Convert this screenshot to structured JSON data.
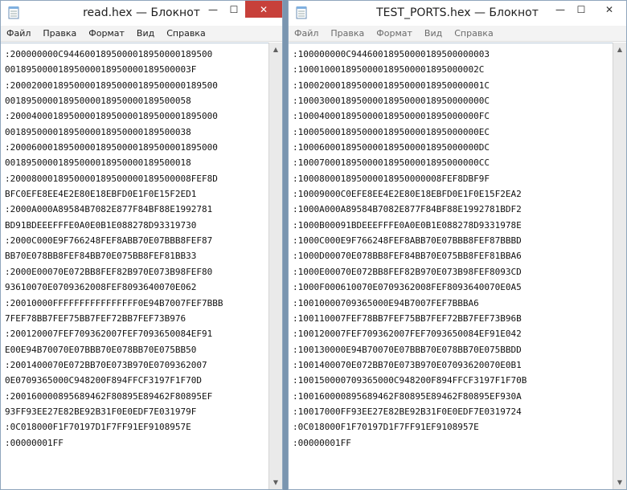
{
  "left_window": {
    "title": "read.hex — Блокнот",
    "menu": [
      "Файл",
      "Правка",
      "Формат",
      "Вид",
      "Справка"
    ],
    "close_glyph": "✕",
    "min_glyph": "—",
    "max_glyph": "☐",
    "lines": [
      ":200000000C9446001895000018950000189500",
      "00189500001895000018950000189500003F",
      ":200020001895000018950000189500000189500",
      "00189500001895000018950000189500058",
      ":200040001895000018950000189500001895000",
      "00189500001895000018950000189500038",
      ":200060001895000018950000189500001895000",
      "00189500001895000018950000189500018",
      ":2000800018950000189500000189500008FEF8D",
      "BFC0EFE8EE4E2E80E18EBFD0E1F0E15F2ED1",
      ":2000A000A89584B7082E877F84BF88E1992781",
      "BD91BDEEEFFFE0A0E0B1E088278D93319730",
      ":2000C000E9F766248FEF8ABB70E07BBB8FEF87",
      "BB70E078BB8FEF84BB70E075BB8FEF81BB33",
      ":2000E00070E072BB8FEF82B970E073B98FEF80",
      "93610070E0709362008FEF8093640070E062",
      ":20010000FFFFFFFFFFFFFFFF0E94B7007FEF7BBB",
      "7FEF78BB7FEF75BB7FEF72BB7FEF73B976",
      ":200120007FEF709362007FEF7093650084EF91",
      "E00E94B70070E07BBB70E078BB70E075BB50",
      ":2001400070E072BB70E073B970E0709362007",
      "0E0709365000C948200F894FFCF3197F1F70D",
      ":200160000895689462F80895E89462F80895EF",
      "93FF93EE27E82BE92B31F0E0EDF7E031979F",
      ":0C018000F1F70197D1F7FF91EF9108957E",
      ":00000001FF"
    ]
  },
  "right_window": {
    "title": "TEST_PORTS.hex — Блокнот",
    "menu": [
      "Файл",
      "Правка",
      "Формат",
      "Вид",
      "Справка"
    ],
    "close_glyph": "✕",
    "min_glyph": "—",
    "max_glyph": "☐",
    "lines": [
      ":100000000C94460018950000189500000003",
      ":1000100018950000189500001895000002C",
      ":10002000189500001895000018950000001C",
      ":10003000189500001895000018950000000C",
      ":1000400018950000189500001895000000FC",
      ":1000500018950000189500001895000000EC",
      ":1000600018950000189500001895000000DC",
      ":1000700018950000189500001895000000CC",
      ":100080001895000018950000008FEF8DBF9F",
      ":10009000C0EFE8EE4E2E80E18EBFD0E1F0E15F2EA2",
      ":1000A000A89584B7082E877F84BF88E1992781BDF2",
      ":1000B00091BDEEEFFFE0A0E0B1E088278D9331978E",
      ":1000C000E9F766248FEF8ABB70E07BBB8FEF87BBBD",
      ":1000D00070E078BB8FEF84BB70E075BB8FEF81BBA6",
      ":1000E00070E072BB8FEF82B970E073B98FEF8093CD",
      ":1000F000610070E0709362008FEF8093640070E0A5",
      ":10010000709365000E94B7007FEF7BBBA6",
      ":100110007FEF78BB7FEF75BB7FEF72BB7FEF73B96B",
      ":100120007FEF709362007FEF7093650084EF91E042",
      ":100130000E94B70070E07BBB70E078BB70E075BBDD",
      ":1001400070E072BB70E073B970E07093620070E0B1",
      ":100150000709365000C948200F894FFCF3197F1F70B",
      ":100160000895689462F80895E89462F80895EF930A",
      ":10017000FF93EE27E82BE92B31F0E0EDF7E0319724",
      ":0C018000F1F70197D1F7FF91EF9108957E",
      ":00000001FF"
    ]
  }
}
